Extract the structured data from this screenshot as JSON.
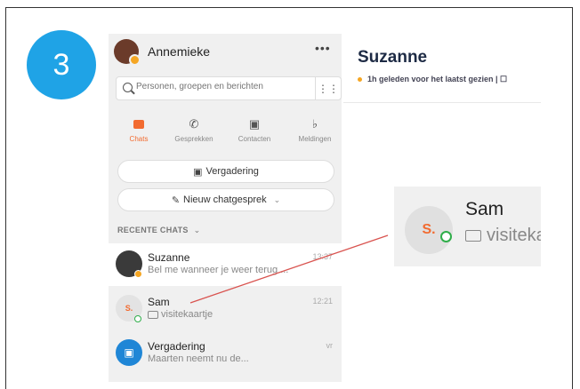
{
  "step": {
    "number": "3",
    "color": "#1fa3e6"
  },
  "sidebar": {
    "profile_name": "Annemieke",
    "more_label": "•••",
    "search_placeholder": "Personen, groepen en berichten",
    "tabs": [
      {
        "label": "Chats",
        "icon": "chat-icon",
        "active": true
      },
      {
        "label": "Gesprekken",
        "icon": "phone-icon",
        "active": false
      },
      {
        "label": "Contacten",
        "icon": "contact-card-icon",
        "active": false
      },
      {
        "label": "Meldingen",
        "icon": "bell-icon",
        "active": false
      }
    ],
    "meeting_button": "Vergadering",
    "new_chat_button": "Nieuw chatgesprek",
    "section_label": "RECENTE CHATS",
    "chats": [
      {
        "name": "Suzanne",
        "preview": "Bel me wanneer je weer terug ...",
        "time": "13:37",
        "status": "away"
      },
      {
        "name": "Sam",
        "avatar_initials": "S.",
        "preview": "visitekaartje",
        "time": "12:21",
        "status": "online"
      },
      {
        "name": "Vergadering",
        "preview": "Maarten  neemt nu de...",
        "time": "vr"
      }
    ]
  },
  "conversation": {
    "title": "Suzanne",
    "status_text": "1h geleden voor het laatst gezien  |  ☐"
  },
  "zoom": {
    "avatar_initials": "S.",
    "name": "Sam",
    "preview": "visitekaartje"
  },
  "colors": {
    "accent": "#f26b30",
    "online": "#2fae4a",
    "away": "#f5a623",
    "pointer": "#d9534f"
  }
}
